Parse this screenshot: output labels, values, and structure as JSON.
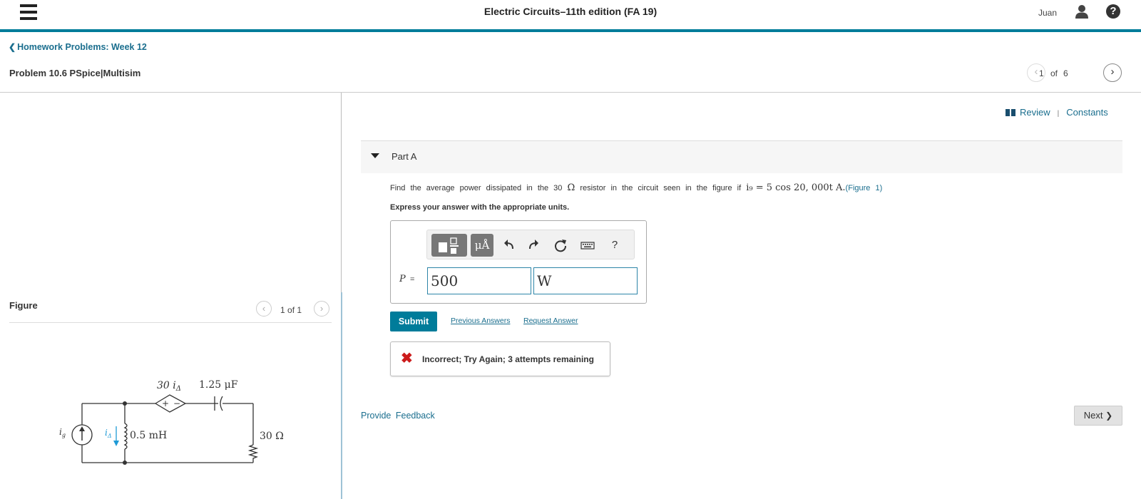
{
  "header": {
    "title": "Electric Circuits–11th edition (FA 19)",
    "user_name": "Juan",
    "help_glyph": "?"
  },
  "breadcrumb": {
    "label": "Homework Problems: Week 12",
    "chevron": "❮"
  },
  "problem": {
    "title": "Problem 10.6 PSpice|Multisim",
    "page_current": "1",
    "page_of": "of",
    "page_total": "6",
    "prev_glyph": "‹",
    "next_glyph": "›"
  },
  "figure": {
    "label": "Figure",
    "page_current": "1",
    "page_of": "of",
    "page_total": "1",
    "labels": {
      "dep_source": "30 i",
      "dep_sub": "Δ",
      "capacitor": "1.25 μF",
      "inductor": "0.5 mH",
      "resistor": "30 Ω",
      "ig": "i",
      "ig_sub": "g",
      "idelta": "i",
      "idelta_sub": "Δ",
      "plus": "+",
      "minus": "−"
    }
  },
  "review": {
    "review_label": "Review",
    "separator": "|",
    "constants_label": "Constants"
  },
  "part": {
    "title": "Part A"
  },
  "question": {
    "text_before": "Find the average power dissipated in the 30",
    "omega": "Ω",
    "text_middle": "resistor in the circuit seen in the figure if",
    "math": "i₉ = 5 cos 20, 000t A.",
    "figure_link": "Figure 1",
    "link_open": "(",
    "link_close": ")",
    "instruction": "Express your answer with the appropriate units."
  },
  "answer": {
    "variable": "P",
    "equals": "=",
    "value": "500",
    "unit": "W",
    "toolbar": {
      "units_label": "μÅ",
      "help_label": "?"
    }
  },
  "actions": {
    "submit_label": "Submit",
    "previous_answers_label": "Previous Answers",
    "request_answer_label": "Request Answer"
  },
  "feedback": {
    "icon": "✖",
    "message": "Incorrect; Try Again; 3 attempts remaining"
  },
  "footer": {
    "provide_feedback_label": "Provide Feedback",
    "next_label": "Next",
    "next_chevron": "❯"
  },
  "colors": {
    "accent": "#007c9a",
    "link": "#1a6e8e",
    "error": "#cc1b1b"
  }
}
